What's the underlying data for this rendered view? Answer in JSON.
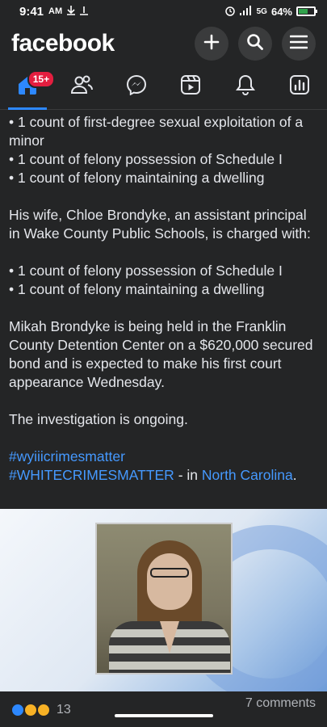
{
  "status_bar": {
    "time": "9:41",
    "ampm": "AM",
    "network": "5G",
    "battery": "64%",
    "battery_level": 0.64,
    "icons": [
      "download-icon",
      "download-icon",
      "alarm-icon",
      "signal-icon",
      "battery-icon"
    ]
  },
  "header": {
    "logo": "facebook",
    "actions": [
      "plus-icon",
      "search-icon",
      "menu-icon"
    ]
  },
  "nav": {
    "badge": "15+",
    "items": [
      "home-icon",
      "friends-icon",
      "messenger-icon",
      "reels-icon",
      "bell-icon",
      "dashboard-icon"
    ]
  },
  "post": {
    "bullets1": [
      "• 1 count of first-degree sexual exploitation of a minor",
      "• 1 count of felony possession of Schedule I",
      "• 1 count of felony maintaining a dwelling"
    ],
    "para_wife": "His wife, Chloe Brondyke, an assistant principal in Wake County Public Schools, is charged with:",
    "bullets2": [
      "• 1 count of felony possession of Schedule I",
      "• 1 count of felony maintaining a dwelling"
    ],
    "para_held": "Mikah Brondyke is being held in the Franklin County Detention Center on a $620,000 secured bond and is expected to make his first court appearance Wednesday.",
    "para_ongoing": "The investigation is ongoing.",
    "hashtag1": "#wyiiicrimesmatter",
    "hashtag2": "#WHITECRIMESMATTER",
    "in_text": " - in ",
    "location": "North Carolina",
    "period": "."
  },
  "footer": {
    "reaction_count": "13",
    "comments": "7 comments"
  },
  "colors": {
    "accent": "#2d88ff",
    "link": "#4599ff",
    "badge": "#e41e3f",
    "background": "#242526"
  }
}
